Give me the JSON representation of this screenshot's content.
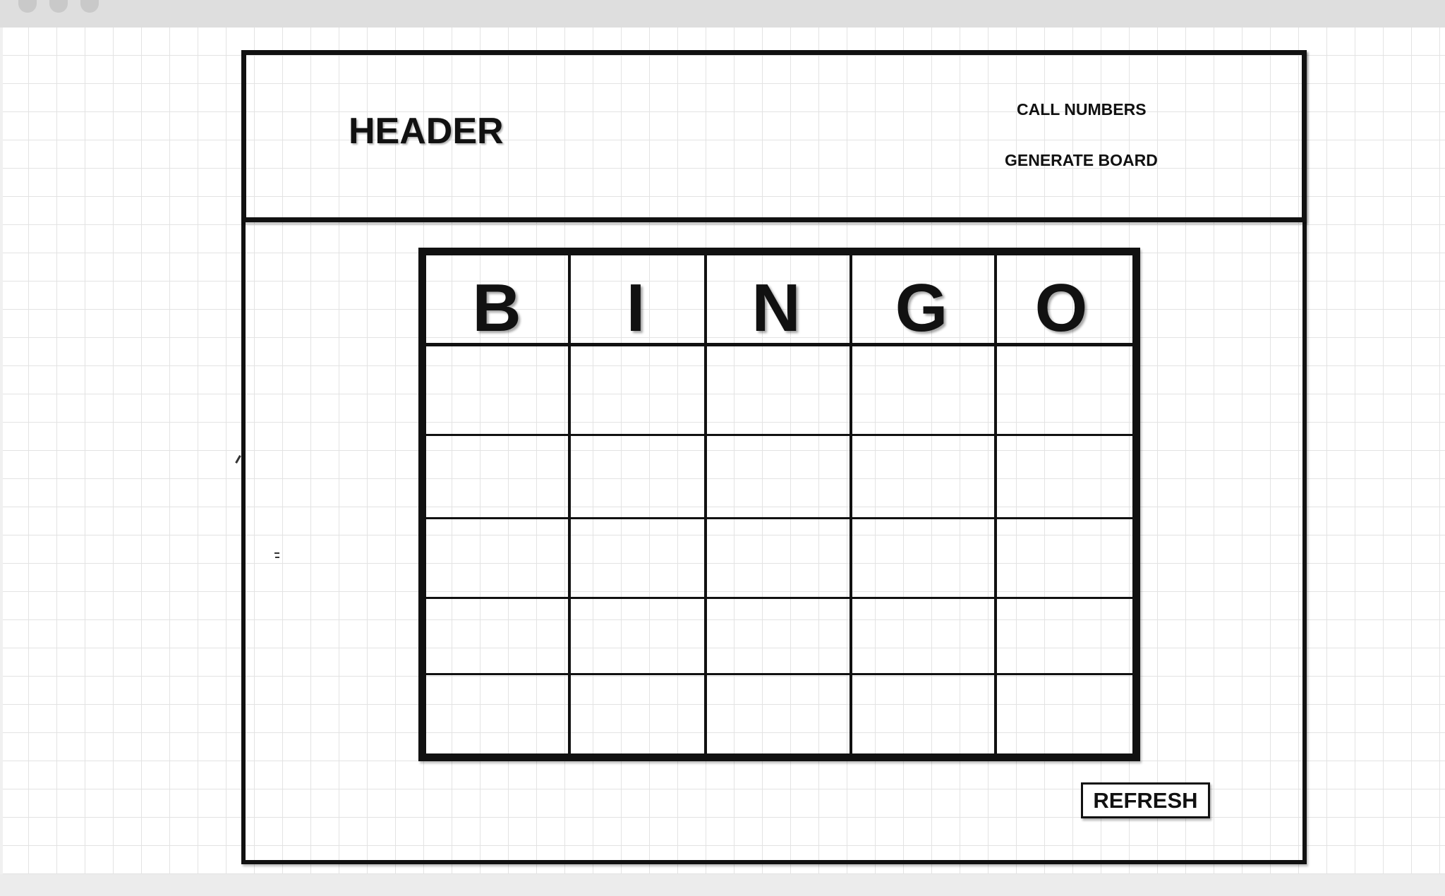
{
  "header": {
    "title": "HEADER",
    "links": [
      {
        "label": "CALL NUMBERS"
      },
      {
        "label": "GENERATE BOARD"
      }
    ]
  },
  "board": {
    "letters": [
      "B",
      "I",
      "N",
      "G",
      "O"
    ],
    "rows": [
      [
        "",
        "",
        "",
        "",
        ""
      ],
      [
        "",
        "",
        "",
        "",
        ""
      ],
      [
        "",
        "",
        "",
        "",
        ""
      ],
      [
        "",
        "",
        "",
        "",
        ""
      ],
      [
        "",
        "",
        "",
        "",
        ""
      ]
    ]
  },
  "refresh_label": "REFRESH",
  "colors": {
    "ink": "#111111",
    "grid_minor": "#e3e3e3",
    "grid_major": "#cfcfcf",
    "titlebar": "#dedede"
  }
}
